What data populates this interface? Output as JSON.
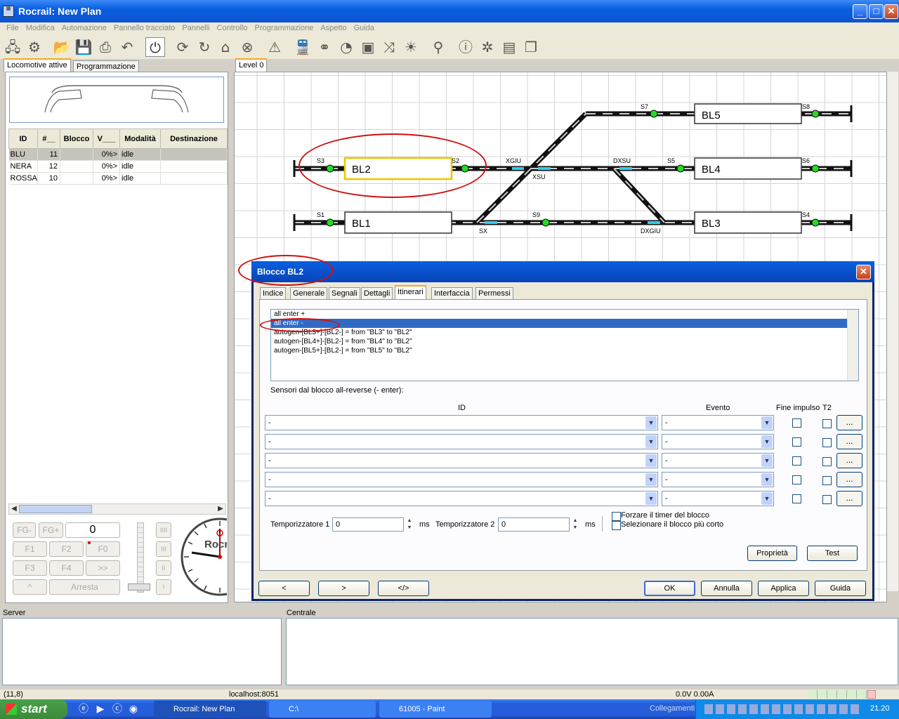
{
  "window": {
    "title": "Rocrail: New Plan"
  },
  "menu": [
    "File",
    "Modifica",
    "Automazione",
    "Pannello tracciato",
    "Pannelli",
    "Controllo",
    "Programmazione",
    "Aspetto",
    "Guida"
  ],
  "toolbar_icons": [
    "connect-icon",
    "settings-icon",
    "open-icon",
    "save-icon",
    "print-icon",
    "undo-icon",
    "power-icon",
    "loop-icon",
    "rotate-icon",
    "home-icon",
    "stop-icon",
    "warning-icon",
    "locomotive-icon",
    "route-icon",
    "speedometer-icon",
    "block-icon",
    "shuffle-icon",
    "light-icon",
    "zoom-icon",
    "info-icon",
    "bug-icon",
    "document-icon",
    "documents-icon"
  ],
  "left_tabs": [
    "Locomotive attive",
    "Programmazione"
  ],
  "loco_table": {
    "headers": [
      "ID",
      "#__",
      "Blocco",
      "V___",
      "Modalità",
      "Destinazione"
    ],
    "rows": [
      [
        "BLU",
        "11",
        "",
        "0%>",
        "idle",
        ""
      ],
      [
        "NERA",
        "12",
        "",
        "0%>",
        "idle",
        ""
      ],
      [
        "ROSSA",
        "10",
        "",
        "0%>",
        "idle",
        ""
      ]
    ]
  },
  "throttle": {
    "buttons": [
      "FG-",
      "FG+",
      "F1",
      "F2",
      "F0",
      "F3",
      "F4",
      ">>",
      "^",
      "Arresta"
    ],
    "speed": "0",
    "side_labels": [
      "IIII",
      "III",
      "II",
      "I"
    ]
  },
  "clock_label": "Rocr",
  "canvas": {
    "level_tab": "Level 0",
    "blocks": [
      "BL5",
      "BL2",
      "BL4",
      "BL1",
      "BL3"
    ],
    "sensors": [
      "S7",
      "S8",
      "S3",
      "S2",
      "S5",
      "S6",
      "S1",
      "S9",
      "S4"
    ],
    "switches": [
      "XGIU",
      "XSU",
      "DXSU",
      "SX",
      "DXGIU"
    ]
  },
  "dialog": {
    "title": "Blocco BL2",
    "tabs": [
      "Indice",
      "Generale",
      "Segnali",
      "Dettagli",
      "Itinerari",
      "Interfaccia",
      "Permessi"
    ],
    "routes": [
      "all enter +",
      "all enter -",
      "autogen-[BL3+]-[BL2-] = from \"BL3\" to \"BL2\"",
      "autogen-[BL4+]-[BL2-] = from \"BL4\" to \"BL2\"",
      "autogen-[BL5+]-[BL2-] = from \"BL5\" to \"BL2\""
    ],
    "sensors_label": "Sensori dal blocco all-reverse (- enter):",
    "col_id": "ID",
    "col_event": "Evento",
    "col_pulse": "Fine impulso",
    "col_t2": "T2",
    "sensor_rows": [
      {
        "id": "-",
        "event": "-"
      },
      {
        "id": "-",
        "event": "-"
      },
      {
        "id": "-",
        "event": "-"
      },
      {
        "id": "-",
        "event": "-"
      },
      {
        "id": "-",
        "event": "-"
      }
    ],
    "ellipsis": "...",
    "timer1_label": "Temporizzatore 1",
    "timer1": "0",
    "timer2_label": "Temporizzatore 2",
    "timer2": "0",
    "ms": "ms",
    "force_timer": "Forzare il timer del blocco",
    "select_shortest": "Selezionare il blocco più corto",
    "properties": "Proprietà",
    "test": "Test",
    "nav_prev": "<",
    "nav_next": ">",
    "nav_xml": "</>",
    "ok": "OK",
    "cancel": "Annulla",
    "apply": "Applica",
    "help": "Guida"
  },
  "bottom": {
    "server": "Server",
    "central": "Centrale"
  },
  "status": {
    "coords": "(11,8)",
    "host": "localhost:8051",
    "power": "0.0V 0.00A"
  },
  "taskbar": {
    "start": "start",
    "items": [
      "Rocrail: New Plan",
      "C:\\",
      "61005 - Paint"
    ],
    "collegamenti": "Collegamenti",
    "time": "21.20"
  },
  "colors": {
    "accent": "#316ac5",
    "title": "#0a5fe0",
    "sensor": "#22dd22",
    "switch_mark": "#33ccee",
    "annotation": "#d01010"
  }
}
